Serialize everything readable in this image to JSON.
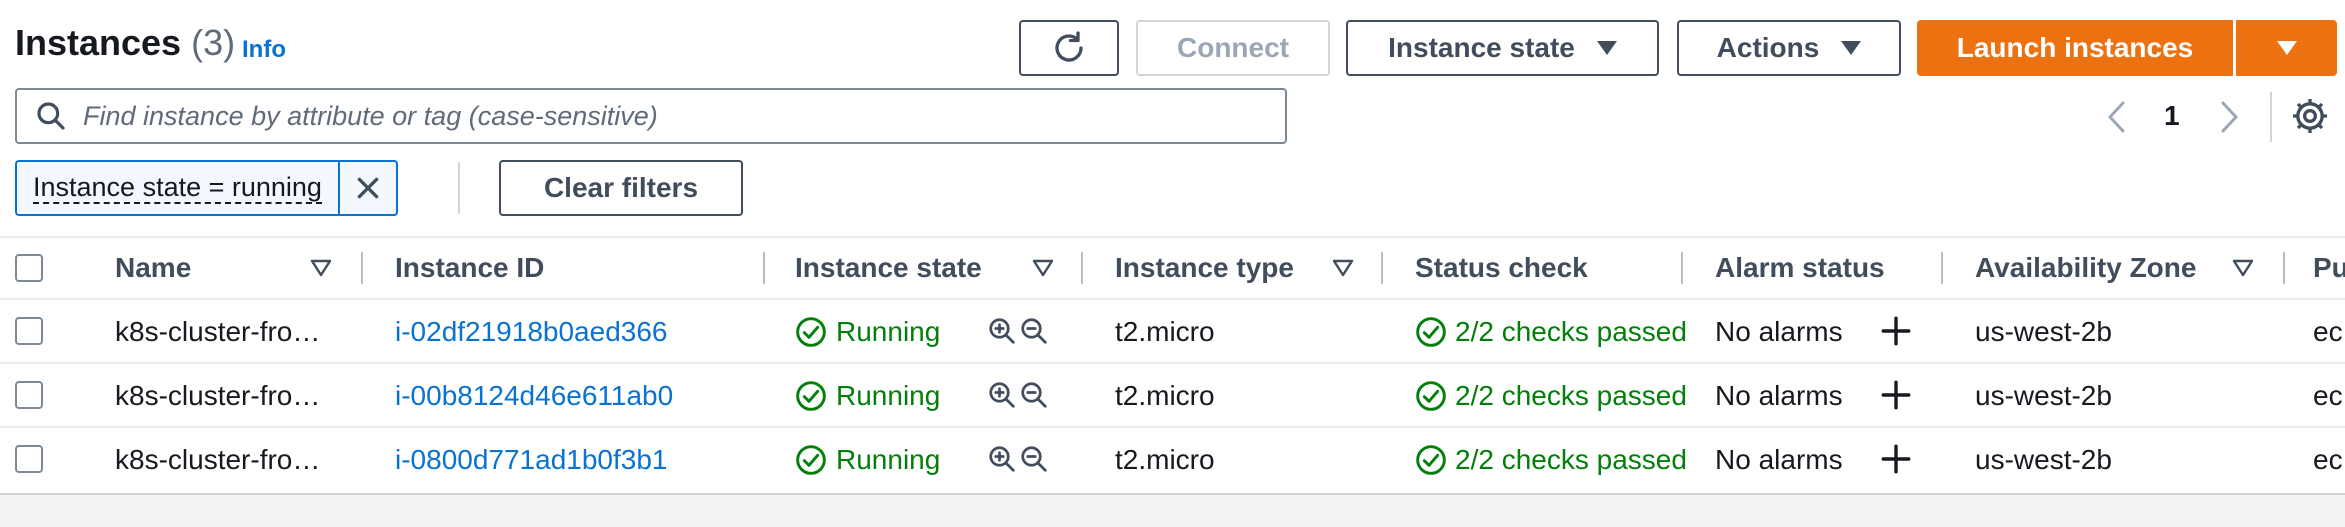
{
  "header": {
    "title": "Instances",
    "count": "(3)",
    "info_link": "Info"
  },
  "toolbar": {
    "connect_label": "Connect",
    "instance_state_label": "Instance state",
    "actions_label": "Actions",
    "launch_label": "Launch instances"
  },
  "search": {
    "placeholder": "Find instance by attribute or tag (case-sensitive)",
    "value": ""
  },
  "pagination": {
    "page": "1"
  },
  "filter": {
    "token_label": "Instance state = running",
    "clear_label": "Clear filters"
  },
  "table": {
    "columns": [
      "Name",
      "Instance ID",
      "Instance state",
      "Instance type",
      "Status check",
      "Alarm status",
      "Availability Zone",
      "Pu"
    ],
    "rows": [
      {
        "name": "k8s-cluster-fro…",
        "instance_id": "i-02df21918b0aed366",
        "state": "Running",
        "type": "t2.micro",
        "status_check": "2/2 checks passed",
        "alarm": "No alarms",
        "az": "us-west-2b",
        "public": "ec"
      },
      {
        "name": "k8s-cluster-fro…",
        "instance_id": "i-00b8124d46e611ab0",
        "state": "Running",
        "type": "t2.micro",
        "status_check": "2/2 checks passed",
        "alarm": "No alarms",
        "az": "us-west-2b",
        "public": "ec"
      },
      {
        "name": "k8s-cluster-fro…",
        "instance_id": "i-0800d771ad1b0f3b1",
        "state": "Running",
        "type": "t2.micro",
        "status_check": "2/2 checks passed",
        "alarm": "No alarms",
        "az": "us-west-2b",
        "public": "ec"
      }
    ]
  },
  "colors": {
    "primary": "#ec7211",
    "link": "#0972d3",
    "success": "#037f0c",
    "text": "#16191f",
    "muted": "#5f6b7a"
  },
  "icons": [
    "refresh-icon",
    "caret-down-icon",
    "search-icon",
    "chevron-left-icon",
    "chevron-right-icon",
    "gear-icon",
    "close-icon",
    "sort-caret-icon",
    "check-circle-icon",
    "zoom-in-icon",
    "zoom-out-icon",
    "plus-icon"
  ]
}
